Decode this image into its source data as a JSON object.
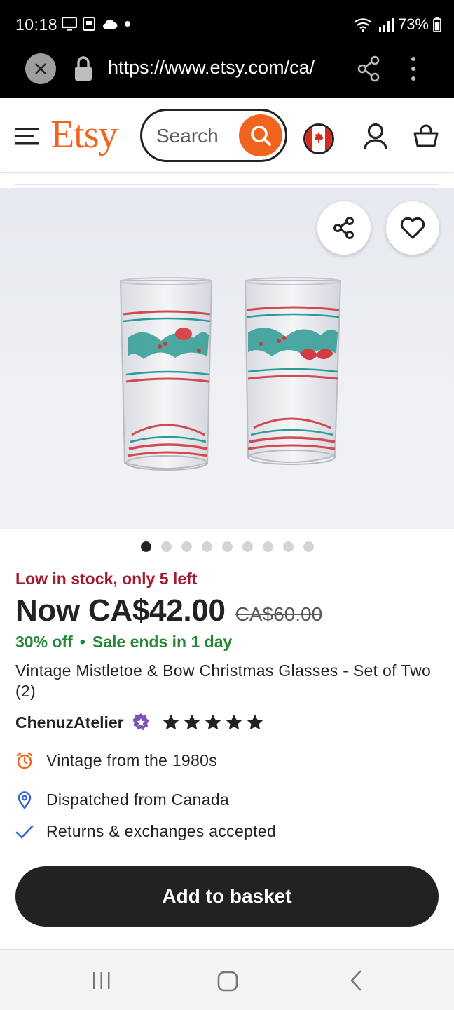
{
  "status_bar": {
    "time": "10:18",
    "battery": "73%"
  },
  "url_bar": {
    "url": "https://www.etsy.com/ca/"
  },
  "header": {
    "logo": "Etsy",
    "search_placeholder": "Search",
    "accent_color": "#f1641e"
  },
  "gallery": {
    "image_count": 9,
    "active_index": 0
  },
  "product": {
    "stock_notice": "Low in stock, only 5 left",
    "price_now": "Now CA$42.00",
    "price_original": "CA$60.00",
    "discount": "30% off",
    "sale_bullet": "•",
    "sale_ends": "Sale ends in 1 day",
    "title": "Vintage Mistletoe & Bow Christmas Glasses - Set of Two (2)",
    "shop_name": "ChenuzAtelier",
    "rating_stars": 5,
    "features": [
      {
        "icon": "alarm-clock-icon",
        "text": "Vintage from the 1980s"
      },
      {
        "icon": "location-pin-icon",
        "text": "Dispatched from Canada"
      },
      {
        "icon": "checkmark-icon",
        "text": "Returns & exchanges accepted"
      }
    ],
    "add_to_basket": "Add to basket"
  }
}
